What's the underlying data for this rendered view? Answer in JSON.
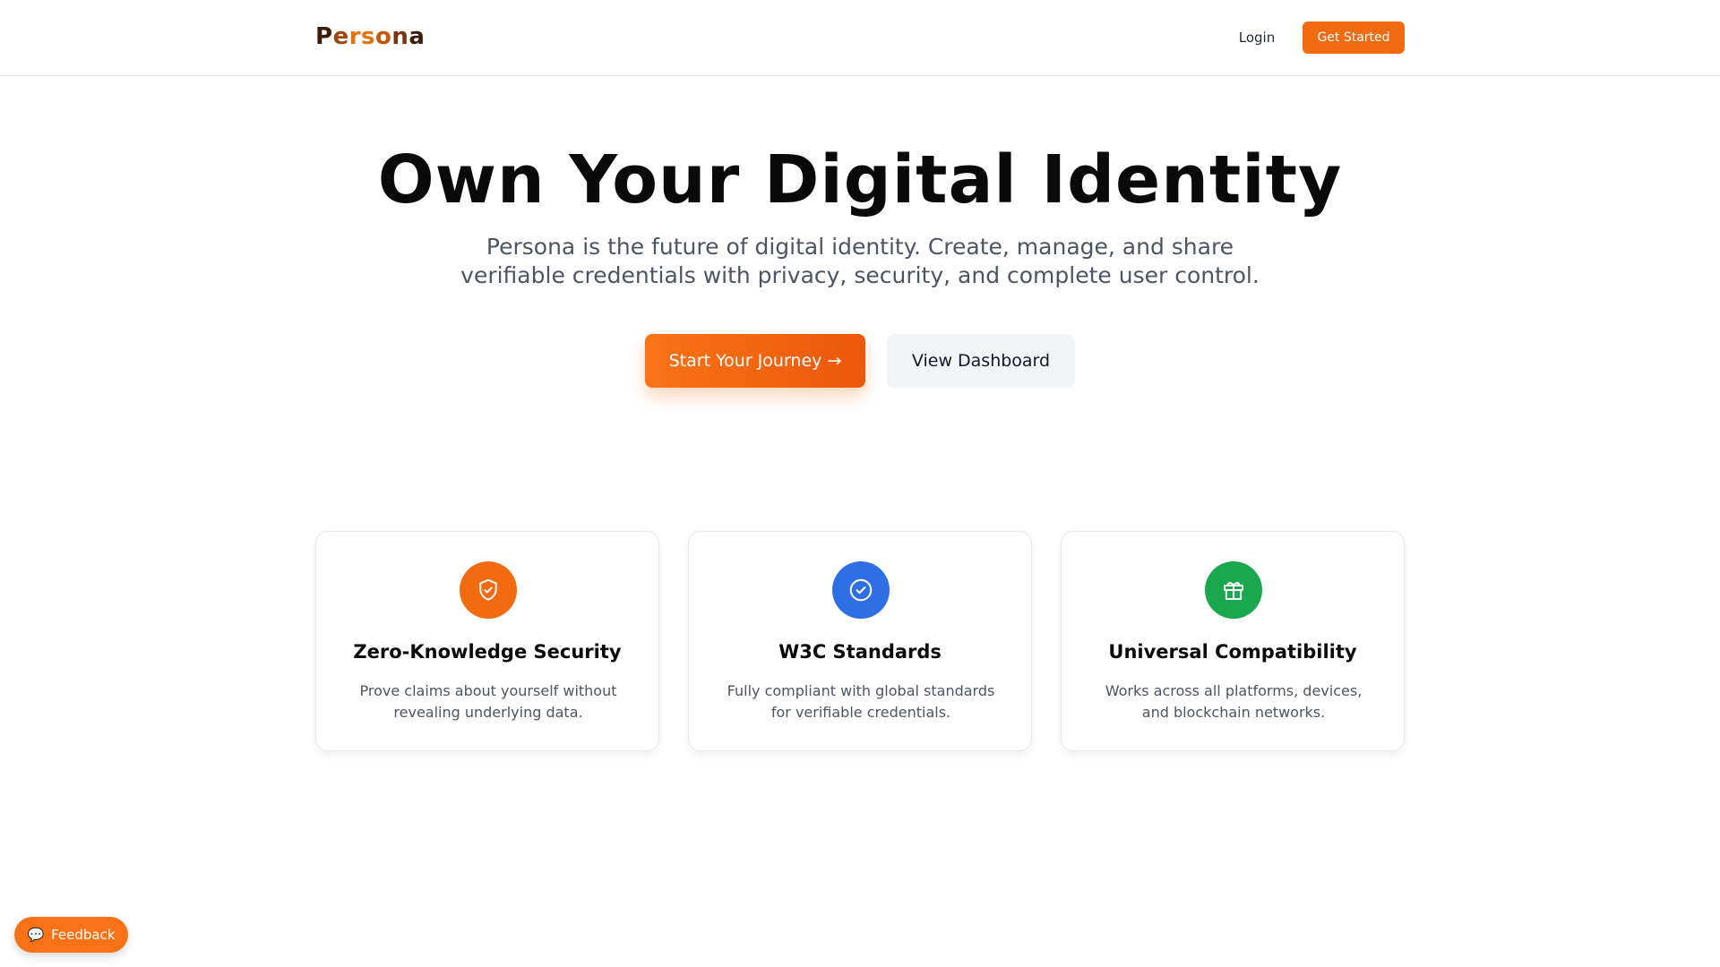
{
  "header": {
    "logo_parts": [
      "P",
      "e",
      "rs",
      "o",
      "n",
      "a"
    ],
    "login_label": "Login",
    "cta_label": "Get Started"
  },
  "hero": {
    "title": "Own Your Digital Identity",
    "subtitle_line1": "Persona is the future of digital identity. Create, manage, and share",
    "subtitle_line2": "verifiable credentials with privacy, security, and complete user control.",
    "primary_label": "Start Your Journey →",
    "secondary_label": "View Dashboard"
  },
  "features": [
    {
      "icon": "shield-check-icon",
      "color": "#f26b11",
      "title": "Zero-Knowledge Security",
      "desc_line1": "Prove claims about yourself without",
      "desc_line2": "revealing underlying data."
    },
    {
      "icon": "check-circle-icon",
      "color": "#2f6fe6",
      "title": "W3C Standards",
      "desc_line1": "Fully compliant with global standards",
      "desc_line2": "for verifiable credentials."
    },
    {
      "icon": "gift-icon",
      "color": "#1aa84f",
      "title": "Universal Compatibility",
      "desc_line1": "Works across all platforms, devices,",
      "desc_line2": "and blockchain networks."
    }
  ],
  "feedback": {
    "icon": "chat-bubble-icon",
    "label": "Feedback"
  }
}
